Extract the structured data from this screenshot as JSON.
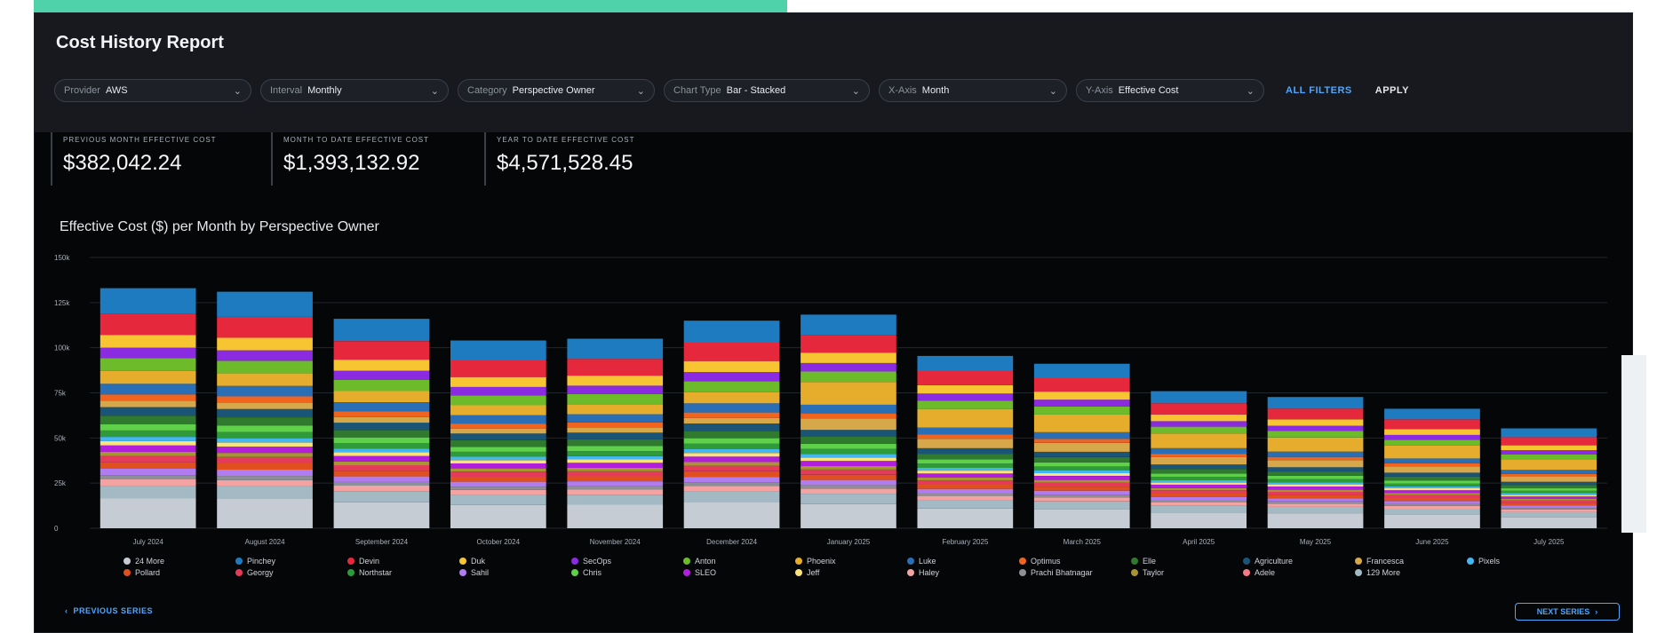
{
  "report": {
    "title": "Cost History Report"
  },
  "filters": [
    {
      "label": "Provider",
      "value": "AWS"
    },
    {
      "label": "Interval",
      "value": "Monthly"
    },
    {
      "label": "Category",
      "value": "Perspective Owner"
    },
    {
      "label": "Chart Type",
      "value": "Bar - Stacked"
    },
    {
      "label": "X-Axis",
      "value": "Month"
    },
    {
      "label": "Y-Axis",
      "value": "Effective Cost"
    }
  ],
  "actions": {
    "all_filters": "ALL FILTERS",
    "apply": "APPLY"
  },
  "metrics": [
    {
      "label": "PREVIOUS MONTH EFFECTIVE COST",
      "value": "$382,042.24"
    },
    {
      "label": "MONTH TO DATE EFFECTIVE COST",
      "value": "$1,393,132.92"
    },
    {
      "label": "YEAR TO DATE EFFECTIVE COST",
      "value": "$4,571,528.45"
    }
  ],
  "chart_data": {
    "type": "bar",
    "stacked": true,
    "title": "Effective Cost ($) per Month by Perspective Owner",
    "xlabel": "",
    "ylabel": "",
    "ylim": [
      0,
      150000
    ],
    "yticks": [
      "0",
      "25k",
      "50k",
      "75k",
      "100k",
      "125k",
      "150k"
    ],
    "categories": [
      "July 2024",
      "August 2024",
      "September 2024",
      "October 2024",
      "November 2024",
      "December 2024",
      "January 2025",
      "February 2025",
      "March 2025",
      "April 2025",
      "May 2025",
      "June 2025",
      "July 2025"
    ],
    "totals": [
      133000,
      131000,
      116000,
      104000,
      105000,
      115000,
      108000,
      88000,
      84000,
      70000,
      67000,
      61000,
      51000
    ],
    "grid": true,
    "legend_position": "bottom",
    "legend": [
      {
        "name": "24 More",
        "color": "#c6ccd4"
      },
      {
        "name": "Pinchey",
        "color": "#1f7bbf"
      },
      {
        "name": "Devin",
        "color": "#e5283b"
      },
      {
        "name": "Duk",
        "color": "#f6c531"
      },
      {
        "name": "SecOps",
        "color": "#8a2be2"
      },
      {
        "name": "Anton",
        "color": "#6dbb2a"
      },
      {
        "name": "Phoenix",
        "color": "#e6ad2d"
      },
      {
        "name": "Luke",
        "color": "#2a6eb5"
      },
      {
        "name": "Optimus",
        "color": "#f0641e"
      },
      {
        "name": "Elle",
        "color": "#2f7a2f"
      },
      {
        "name": "Agriculture",
        "color": "#1a5577"
      },
      {
        "name": "Francesca",
        "color": "#d7a84a"
      },
      {
        "name": "Pixels",
        "color": "#45b7f0"
      },
      {
        "name": "Pollard",
        "color": "#e0501e"
      },
      {
        "name": "Georgy",
        "color": "#e43b5b"
      },
      {
        "name": "Northstar",
        "color": "#2f9a3a"
      },
      {
        "name": "Sahil",
        "color": "#b07cf0"
      },
      {
        "name": "Chris",
        "color": "#5ed04a"
      },
      {
        "name": "SLEO",
        "color": "#b21fdc"
      },
      {
        "name": "Jeff",
        "color": "#fbe27a"
      },
      {
        "name": "Haley",
        "color": "#f4a3a3"
      },
      {
        "name": "Prachi Bhatnagar",
        "color": "#8c8f96"
      },
      {
        "name": "Taylor",
        "color": "#a89430"
      },
      {
        "name": "Adele",
        "color": "#f47a8a"
      },
      {
        "name": "129 More",
        "color": "#a3b9c4"
      }
    ]
  },
  "pager": {
    "prev": "PREVIOUS SERIES",
    "next": "NEXT SERIES"
  },
  "colors": {
    "accent": "#4fd1a9",
    "link": "#4ea7ff",
    "background": "#050608"
  }
}
